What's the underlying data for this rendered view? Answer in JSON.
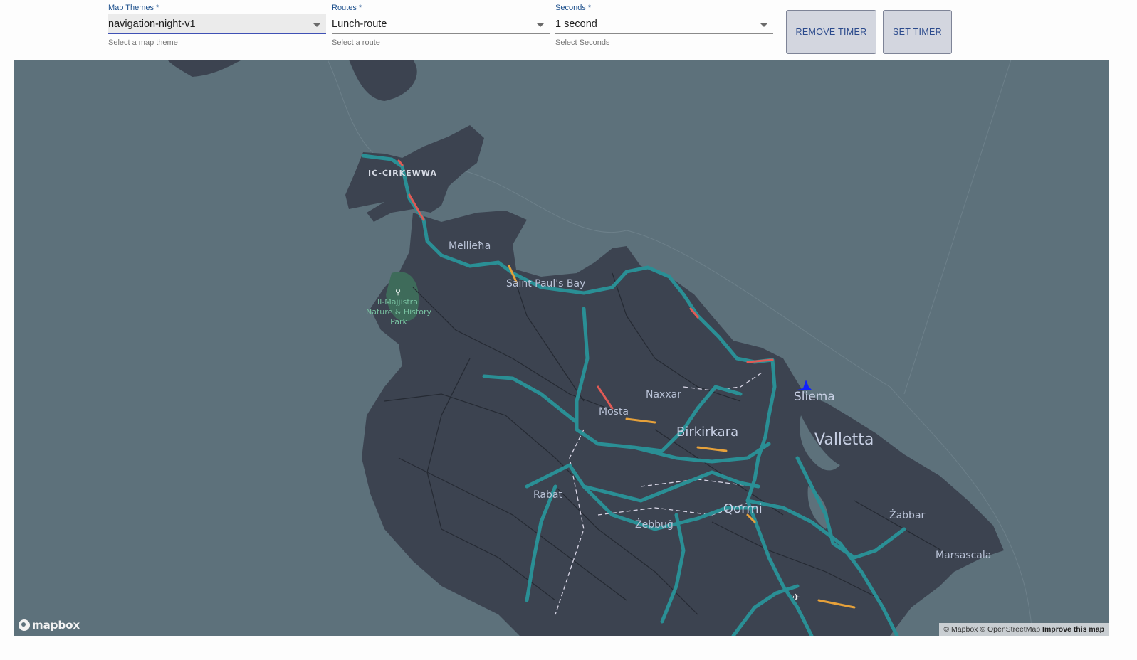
{
  "controls": {
    "map_theme": {
      "label": "Map Themes *",
      "value": "navigation-night-v1",
      "helper": "Select a map theme"
    },
    "route": {
      "label": "Routes *",
      "value": "Lunch-route",
      "helper": "Select a route"
    },
    "seconds": {
      "label": "Seconds *",
      "value": "1 second",
      "helper": "Select Seconds"
    },
    "remove_timer_label": "REMOVE TIMER",
    "set_timer_label": "SET TIMER"
  },
  "map": {
    "places": {
      "cirkewwa": "IĊ-ĊIRKEWWA",
      "mellieha": "Mellieħa",
      "saint_pauls_bay": "Saint Paul's Bay",
      "majjistral_park": "Il-Majjistral Nature & History Park",
      "naxxar": "Naxxar",
      "mosta": "Mosta",
      "birkirkara": "Birkirkara",
      "sliema": "Sliema",
      "valletta": "Valletta",
      "rabat": "Rabat",
      "qormi": "Qormi",
      "zebbug": "Żebbuġ",
      "zabbar": "Żabbar",
      "marsascala": "Marsascala"
    },
    "logo_text": "mapbox",
    "attribution": {
      "mapbox": "© Mapbox",
      "osm": "© OpenStreetMap",
      "improve": "Improve this map"
    },
    "icons": {
      "park": "tree-icon",
      "airport": "airplane-icon",
      "position": "location-marker-icon"
    },
    "colors": {
      "water": "#5d717b",
      "land": "#3c4350",
      "route": "#2a8f95",
      "traffic_moderate": "#e6a13a",
      "traffic_heavy": "#e05a55",
      "park": "#3e6b5a",
      "marker": "#1020ff"
    }
  }
}
